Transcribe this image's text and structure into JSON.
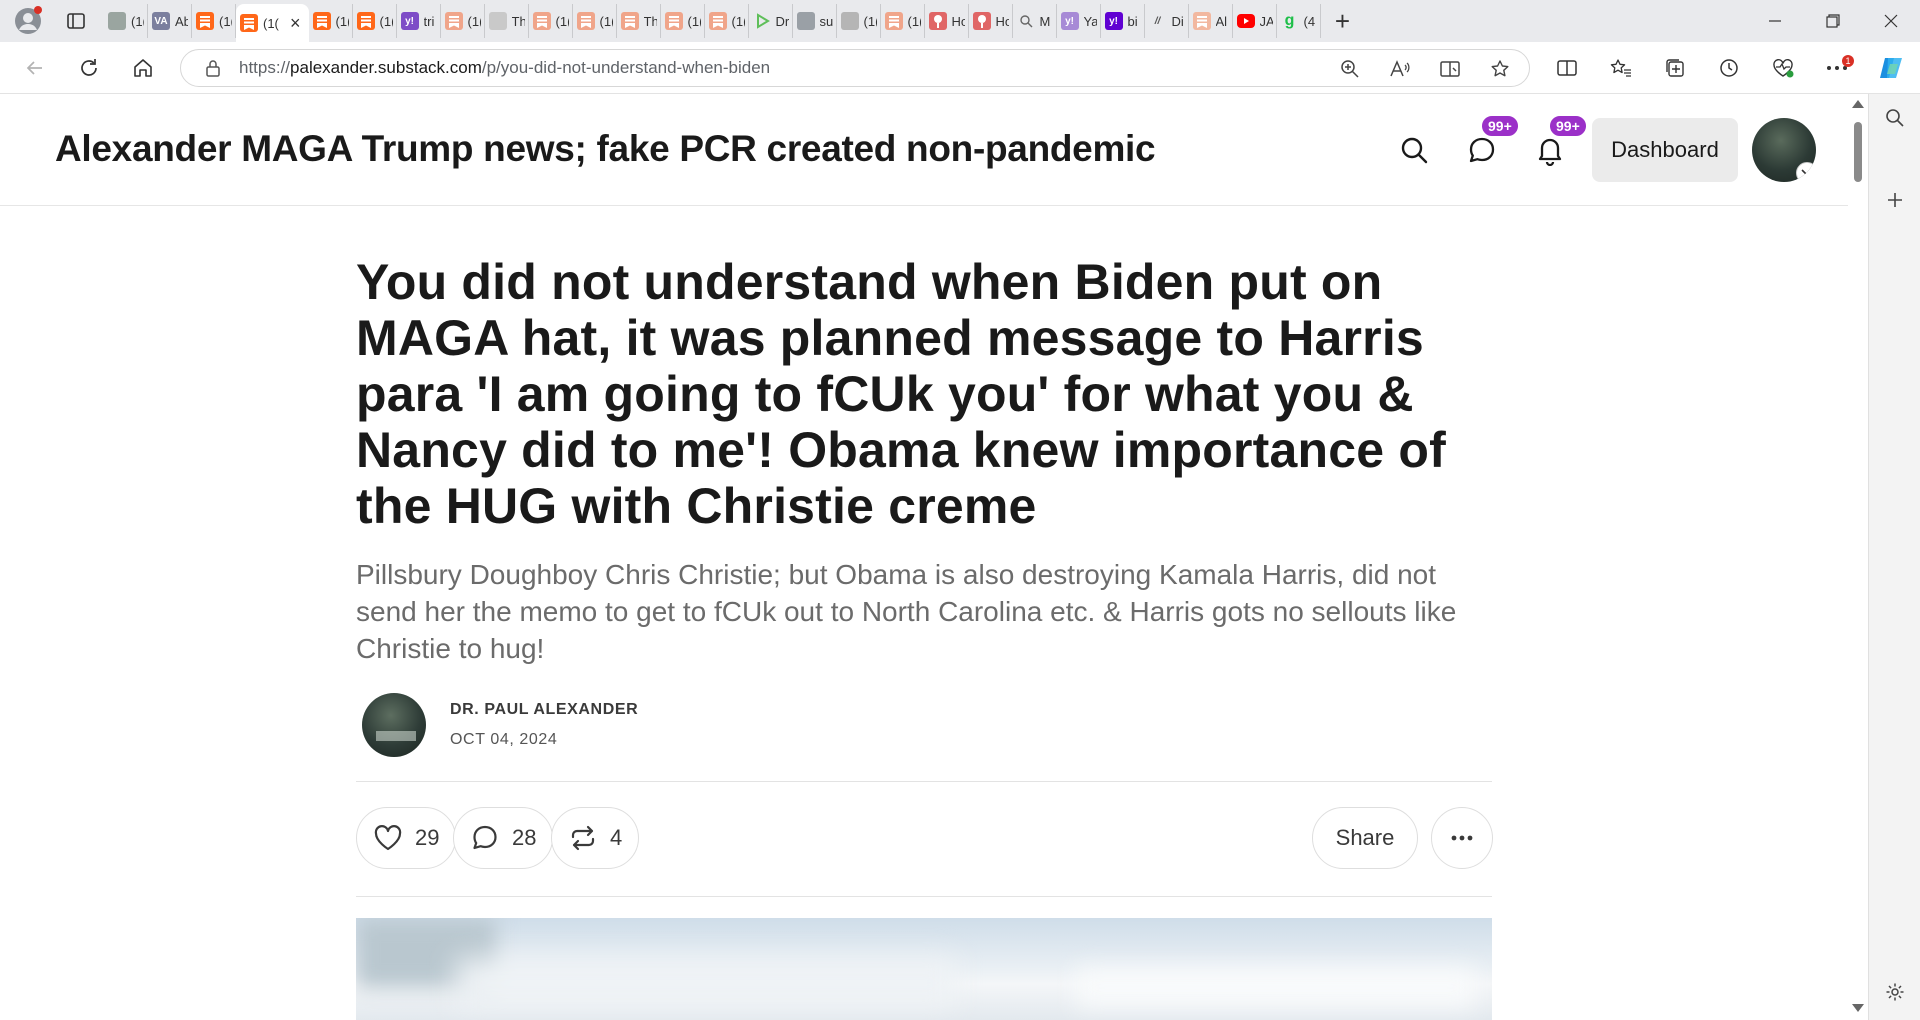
{
  "browser": {
    "tabs": [
      {
        "title": "(1(",
        "fav": "img",
        "color": "#9aa5a0"
      },
      {
        "title": "Ab",
        "fav": "VA",
        "color": "#7b7f9e"
      },
      {
        "title": "(1(",
        "fav": "substack",
        "color": "#ff6719"
      },
      {
        "title": "(1(",
        "fav": "substack",
        "color": "#ff6719",
        "active": true
      },
      {
        "title": "(1(",
        "fav": "substack",
        "color": "#ff6719"
      },
      {
        "title": "(1(",
        "fav": "substack",
        "color": "#ff6719"
      },
      {
        "title": "tri",
        "fav": "y!",
        "color": "#7e4cc7"
      },
      {
        "title": "(1(",
        "fav": "substack",
        "color": "#f0a58a"
      },
      {
        "title": "Th",
        "fav": "doc",
        "color": "#c9c9c9"
      },
      {
        "title": "(1(",
        "fav": "substack",
        "color": "#f0a58a"
      },
      {
        "title": "(1(",
        "fav": "substack",
        "color": "#f0a58a"
      },
      {
        "title": "Th",
        "fav": "substack",
        "color": "#f0a58a"
      },
      {
        "title": "(1(",
        "fav": "substack",
        "color": "#f0a58a"
      },
      {
        "title": "(1(",
        "fav": "substack",
        "color": "#f0a58a"
      },
      {
        "title": "Dr",
        "fav": "play",
        "color": "#5fbf5a"
      },
      {
        "title": "su",
        "fav": "doc",
        "color": "#9aa0a6"
      },
      {
        "title": "(1(",
        "fav": "img",
        "color": "#b5b5b5"
      },
      {
        "title": "(1(",
        "fav": "substack",
        "color": "#f0a58a"
      },
      {
        "title": "Ho",
        "fav": "pin",
        "color": "#e06666"
      },
      {
        "title": "Ho",
        "fav": "pin",
        "color": "#e06666"
      },
      {
        "title": "M",
        "fav": "search",
        "color": "#9aa0a6"
      },
      {
        "title": "Ya",
        "fav": "y!",
        "color": "#a78ad6"
      },
      {
        "title": "bi",
        "fav": "y!",
        "color": "#6001d2"
      },
      {
        "title": "Di",
        "fav": "//",
        "color": "#555555"
      },
      {
        "title": "Al",
        "fav": "substack",
        "color": "#f2b8a0"
      },
      {
        "title": "JA",
        "fav": "yt",
        "color": "#ff0000"
      },
      {
        "title": "(4",
        "fav": "g",
        "color": "#1fbf4a"
      }
    ],
    "active_tab_close": "×",
    "new_tab": "+",
    "url_prefix": "https://",
    "url_host": "palexander.substack.com",
    "url_path": "/p/you-did-not-understand-when-biden"
  },
  "site": {
    "title": "Alexander MAGA Trump news; fake PCR created non-pandemic",
    "chat_badge": "99+",
    "notif_badge": "99+",
    "dashboard_label": "Dashboard"
  },
  "post": {
    "headline": "You did not understand when Biden put on MAGA hat, it was planned message to Harris para 'I am going to fCUk you' for what you & Nancy did to me'! Obama knew importance of the HUG with Christie creme",
    "subtitle": "Pillsbury Doughboy Chris Christie; but Obama is also destroying Kamala Harris, did not send her the memo to get to fCUk out to North Carolina etc. & Harris gots no sellouts like Christie to hug!",
    "author": "DR. PAUL ALEXANDER",
    "date": "OCT 04, 2024",
    "likes": "29",
    "comments": "28",
    "restacks": "4",
    "share_label": "Share",
    "more_label": "•••"
  }
}
